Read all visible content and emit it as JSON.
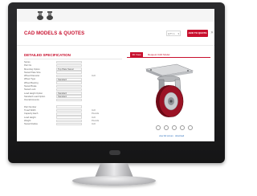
{
  "header": {
    "title": "CAD MODELS & QUOTES",
    "count_value": "QTY 1",
    "go_button": "ADD TO QUOTE"
  },
  "spec": {
    "title": "DETAILED SPECIFICATION",
    "rows": [
      {
        "label": "Series",
        "value": "",
        "unit": ""
      },
      {
        "label": "Part No.",
        "value": "",
        "unit": ""
      },
      {
        "label": "Mounting Option",
        "value": "Top Plate Swivel",
        "unit": ""
      },
      {
        "label": "Swivel Plate Size",
        "value": "",
        "unit": ""
      },
      {
        "label": "Wheel Diameter",
        "value": "",
        "unit": "Inch"
      },
      {
        "label": "Wheel Type",
        "value": "Standard",
        "unit": ""
      },
      {
        "label": "Wheel Bearing",
        "value": "",
        "unit": ""
      },
      {
        "label": "Swivel Brake",
        "value": "",
        "unit": ""
      },
      {
        "label": "Swivel Lock",
        "value": "",
        "unit": ""
      },
      {
        "label": "Load Height Option",
        "value": "Standard",
        "unit": ""
      },
      {
        "label": "Standard Load Option",
        "value": "Standard",
        "unit": ""
      },
      {
        "label": "Overall Accents",
        "value": "",
        "unit": ""
      },
      {
        "label": "",
        "value": "",
        "unit": ""
      },
      {
        "label": "Part Number",
        "value": "",
        "unit": ""
      },
      {
        "label": "Tread Width",
        "value": "",
        "unit": "Inch"
      },
      {
        "label": "Capacity Each",
        "value": "",
        "unit": "Pounds"
      },
      {
        "label": "Load Height",
        "value": "",
        "unit": "Inch"
      },
      {
        "label": "Weight",
        "value": "",
        "unit": "Pounds"
      },
      {
        "label": "Swivel Radius",
        "value": "",
        "unit": "Inch"
      }
    ]
  },
  "viewer": {
    "tab_active": "3D View",
    "tab_inactive": "Request CAD Model",
    "link_text": "view full screen · download",
    "tools": [
      "rotate-icon",
      "pan-icon",
      "zoom-icon",
      "reset-icon",
      "fullscreen-icon"
    ]
  },
  "colors": {
    "brand_red": "#c8102e",
    "wheel_red": "#8e1020",
    "monitor_bezel": "#1c1c1e"
  }
}
